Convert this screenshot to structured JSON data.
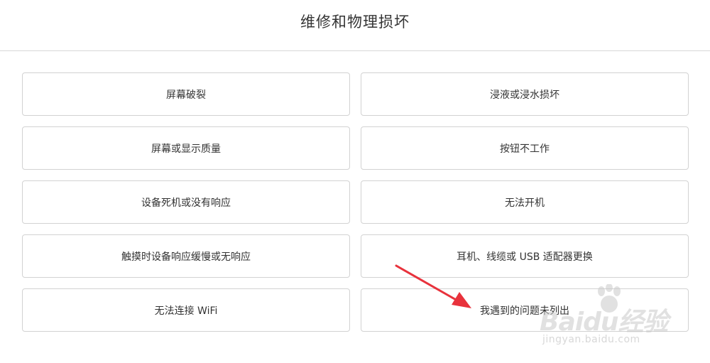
{
  "header": {
    "title": "维修和物理损坏"
  },
  "options": [
    {
      "label": "屏幕破裂"
    },
    {
      "label": "浸液或浸水损坏"
    },
    {
      "label": "屏幕或显示质量"
    },
    {
      "label": "按钮不工作"
    },
    {
      "label": "设备死机或没有响应"
    },
    {
      "label": "无法开机"
    },
    {
      "label": "触摸时设备响应缓慢或无响应"
    },
    {
      "label": "耳机、线缆或 USB 适配器更换"
    },
    {
      "label": "无法连接 WiFi"
    },
    {
      "label": "我遇到的问题未列出"
    }
  ],
  "annotation": {
    "arrow_color": "#e8323c",
    "points_to": "我遇到的问题未列出"
  },
  "watermark": {
    "logo_text": "Baidu经验",
    "url_text": "jingyan.baidu.com"
  }
}
